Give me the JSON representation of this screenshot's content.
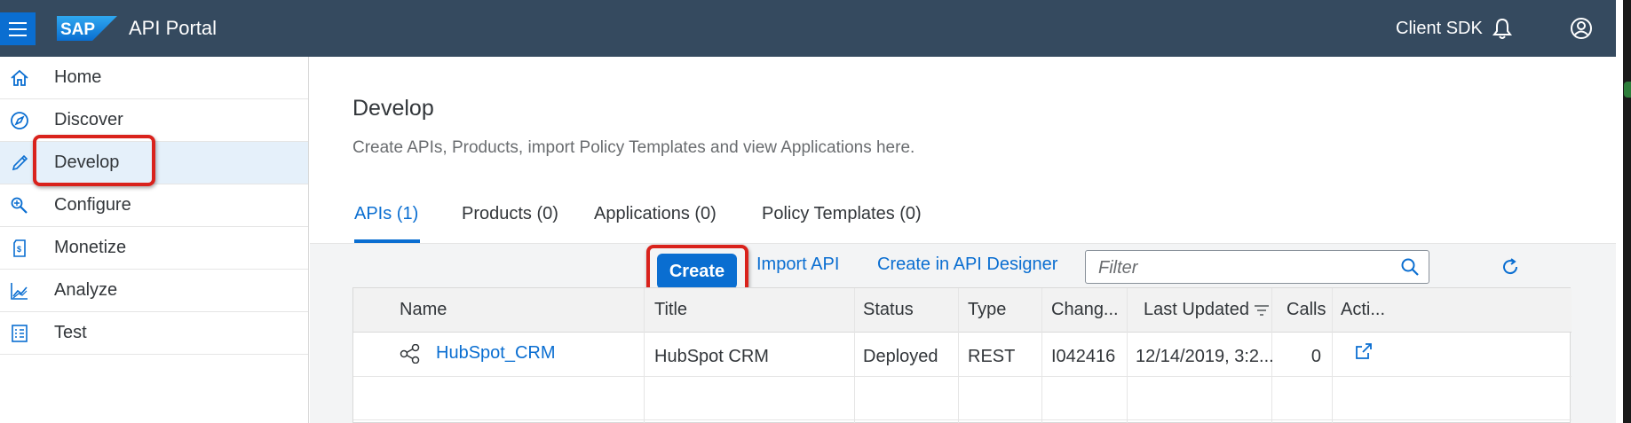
{
  "shell": {
    "app_title": "API Portal",
    "logo_text": "SAP",
    "user_label": "Client SDK",
    "brand_color": "#354a5f",
    "menu_icon": "hamburger-icon",
    "notification_icon": "bell-icon",
    "user_icon": "user-avatar-icon"
  },
  "sidebar": {
    "items": [
      {
        "label": "Home",
        "icon": "home-icon"
      },
      {
        "label": "Discover",
        "icon": "compass-icon"
      },
      {
        "label": "Develop",
        "icon": "pencil-icon",
        "selected": true
      },
      {
        "label": "Configure",
        "icon": "configure-icon"
      },
      {
        "label": "Monetize",
        "icon": "monetize-icon"
      },
      {
        "label": "Analyze",
        "icon": "analyze-chart-icon"
      },
      {
        "label": "Test",
        "icon": "test-checklist-icon"
      }
    ]
  },
  "main": {
    "title": "Develop",
    "description": "Create APIs, Products, import Policy Templates and view Applications here.",
    "tabs": [
      {
        "label": "APIs (1)",
        "active": true
      },
      {
        "label": "Products (0)"
      },
      {
        "label": "Applications (0)"
      },
      {
        "label": "Policy Templates (0)"
      }
    ],
    "toolbar": {
      "create_label": "Create",
      "import_label": "Import API",
      "designer_label": "Create in API Designer",
      "filter_placeholder": "Filter"
    },
    "table": {
      "columns": [
        "Name",
        "Title",
        "Status",
        "Type",
        "Chang...",
        "Last Updated",
        "Calls",
        "Acti..."
      ],
      "rows": [
        {
          "name": "HubSpot_CRM",
          "title": "HubSpot CRM",
          "status": "Deployed",
          "type": "REST",
          "changed_by": "I042416",
          "last_updated": "12/14/2019, 3:2...",
          "calls": "0"
        }
      ]
    }
  },
  "colors": {
    "accent": "#0a6ed1",
    "highlight": "#d9221c",
    "selected_nav": "#e5f0fa"
  }
}
